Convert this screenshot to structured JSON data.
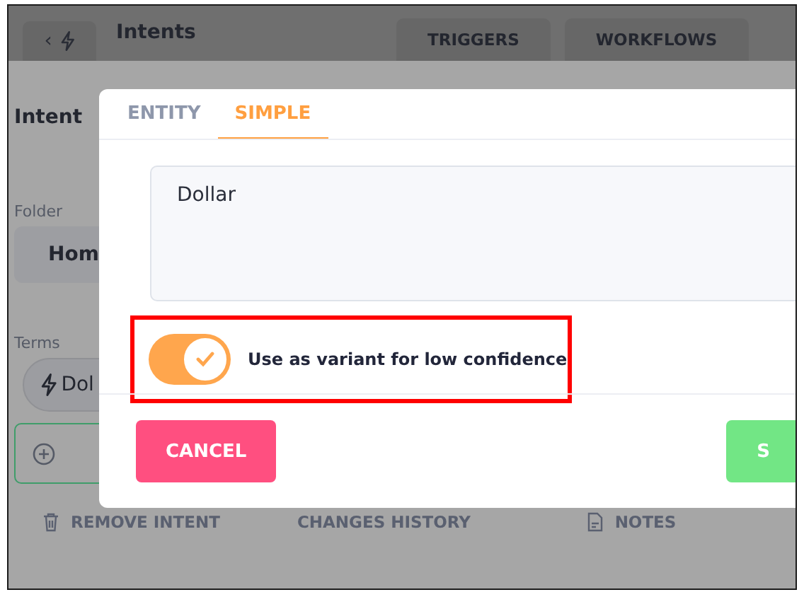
{
  "header": {
    "back_glyph": "‹",
    "title": "Intents",
    "tabs": [
      {
        "label": "TRIGGERS"
      },
      {
        "label": "WORKFLOWS"
      }
    ]
  },
  "background": {
    "intent_label": "Intent",
    "folder_label": "Folder",
    "folder_value": "Hom",
    "terms_label": "Terms",
    "term_chip": "Dol",
    "actions": [
      {
        "label": "REMOVE INTENT",
        "kind": "delete"
      },
      {
        "label": "CHANGES HISTORY",
        "kind": "plain"
      },
      {
        "label": "NOTES",
        "kind": "notes"
      }
    ]
  },
  "dialog": {
    "tabs": [
      {
        "label": "ENTITY",
        "selected": false
      },
      {
        "label": "SIMPLE",
        "selected": true
      }
    ],
    "value": "Dollar",
    "variant_toggle": {
      "label": "Use as variant for low confidence",
      "on": true,
      "highlighted": true
    },
    "cancel": "CANCEL",
    "submit": "S"
  }
}
